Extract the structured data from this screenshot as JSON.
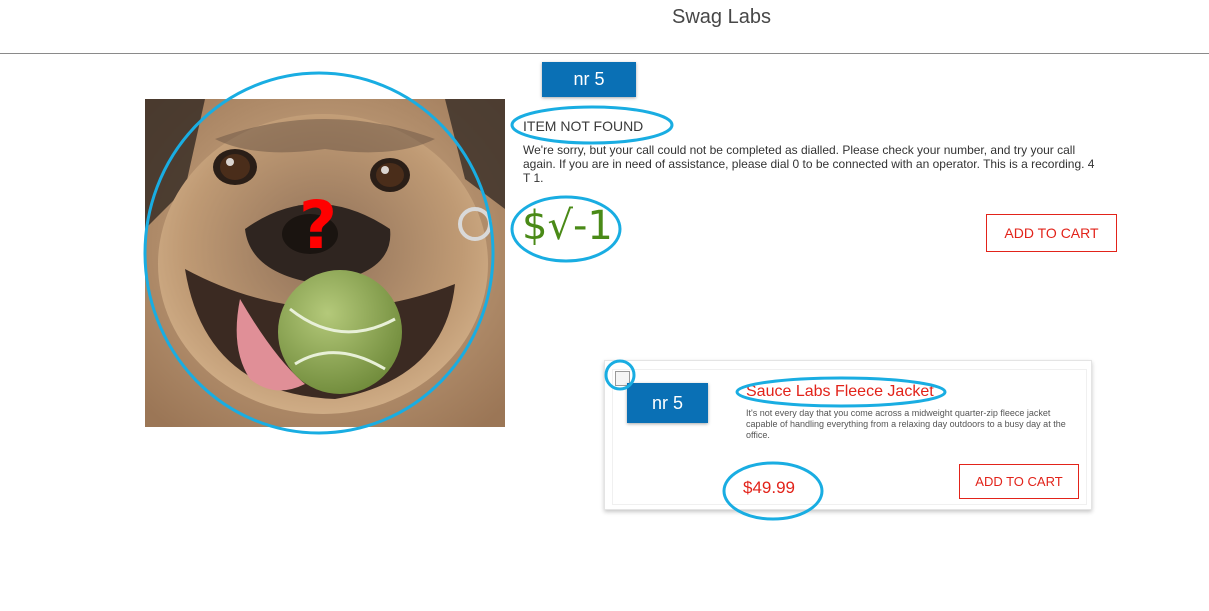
{
  "header": {
    "title": "Swag Labs"
  },
  "top_badge": "nr 5",
  "item": {
    "image_icon": "pug-with-tennis-ball-photo",
    "mark_glyph": "?",
    "name": "ITEM NOT FOUND",
    "description": "We're sorry, but your call could not be completed as dialled. Please check your number, and try your call again. If you are in need of assistance, please dial 0 to be connected with an operator. This is a recording. 4 T 1.",
    "price": "$√-1",
    "add_to_cart": "ADD TO CART"
  },
  "card": {
    "image_icon": "broken-image-icon",
    "badge": "nr 5",
    "name": "Sauce Labs Fleece Jacket",
    "description": "It's not every day that you come across a midweight quarter-zip fleece jacket capable of handling everything from a relaxing day outdoors to a busy day at the office.",
    "price": "$49.99",
    "add_to_cart": "ADD TO CART"
  },
  "colors": {
    "accent_red": "#e2231a",
    "badge_blue": "#0a70b5",
    "price_green": "#4a8a17",
    "annotation_cyan": "#19ade2",
    "question_red": "#ff0000"
  }
}
